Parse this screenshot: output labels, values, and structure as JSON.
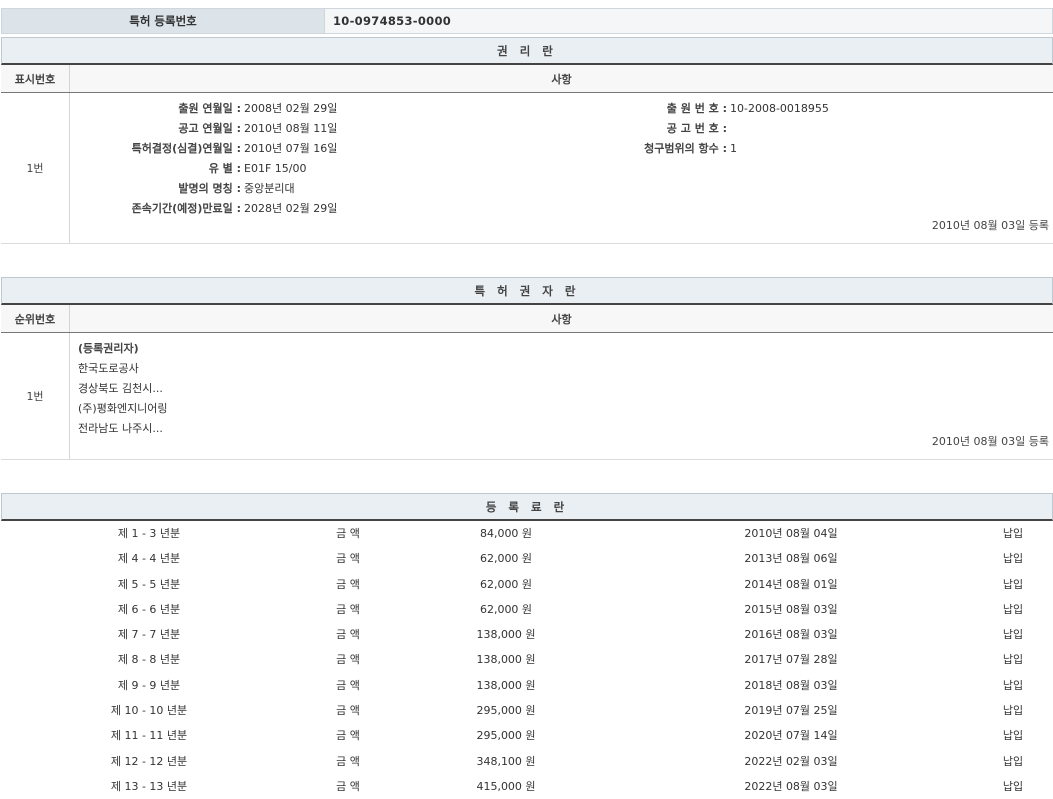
{
  "registration": {
    "label": "특허 등록번호",
    "number": "10-0974853-0000"
  },
  "rights": {
    "title": "권 리 란",
    "col1": "표시번호",
    "col2": "사항",
    "entry_no": "1번",
    "left_fields": [
      {
        "label": "출원 연월일 :",
        "value": "2008년 02월 29일"
      },
      {
        "label": "공고 연월일 :",
        "value": "2010년 08월 11일"
      },
      {
        "label": "특허결정(심결)연월일 :",
        "value": "2010년 07월 16일"
      },
      {
        "label": "유 별 :",
        "value": "E01F 15/00"
      },
      {
        "label": "발명의 명칭 :",
        "value": "중앙분리대"
      },
      {
        "label": "존속기간(예정)만료일 :",
        "value": "2028년 02월 29일"
      }
    ],
    "right_fields": [
      {
        "label": "출 원 번 호 :",
        "value": "10-2008-0018955"
      },
      {
        "label": "공 고 번 호 :",
        "value": ""
      },
      {
        "label": "청구범위의 항수 :",
        "value": "1"
      }
    ],
    "registered": "2010년 08월 03일 등록"
  },
  "owners": {
    "title": "특 허 권 자 란",
    "col1": "순위번호",
    "col2": "사항",
    "entry_no": "1번",
    "heading": "(등록권리자)",
    "lines": [
      "한국도로공사",
      "경상북도 김천시...",
      "(주)평화엔지니어링",
      "전라남도 나주시..."
    ],
    "registered": "2010년 08월 03일 등록"
  },
  "fees": {
    "title": "등 록 료 란",
    "amount_label": "금 액",
    "rows": [
      {
        "period": "제 1 - 3 년분",
        "amount": "84,000 원",
        "date": "2010년 08월 04일",
        "status": "납입"
      },
      {
        "period": "제 4 - 4 년분",
        "amount": "62,000 원",
        "date": "2013년 08월 06일",
        "status": "납입"
      },
      {
        "period": "제 5 - 5 년분",
        "amount": "62,000 원",
        "date": "2014년 08월 01일",
        "status": "납입"
      },
      {
        "period": "제 6 - 6 년분",
        "amount": "62,000 원",
        "date": "2015년 08월 03일",
        "status": "납입"
      },
      {
        "period": "제 7 - 7 년분",
        "amount": "138,000 원",
        "date": "2016년 08월 03일",
        "status": "납입"
      },
      {
        "period": "제 8 - 8 년분",
        "amount": "138,000 원",
        "date": "2017년 07월 28일",
        "status": "납입"
      },
      {
        "period": "제 9 - 9 년분",
        "amount": "138,000 원",
        "date": "2018년 08월 03일",
        "status": "납입"
      },
      {
        "period": "제 10 - 10 년분",
        "amount": "295,000 원",
        "date": "2019년 07월 25일",
        "status": "납입"
      },
      {
        "period": "제 11 - 11 년분",
        "amount": "295,000 원",
        "date": "2020년 07월 14일",
        "status": "납입"
      },
      {
        "period": "제 12 - 12 년분",
        "amount": "348,100 원",
        "date": "2022년 02월 03일",
        "status": "납입"
      },
      {
        "period": "제 13 - 13 년분",
        "amount": "415,000 원",
        "date": "2022년 08월 03일",
        "status": "납입"
      }
    ]
  }
}
